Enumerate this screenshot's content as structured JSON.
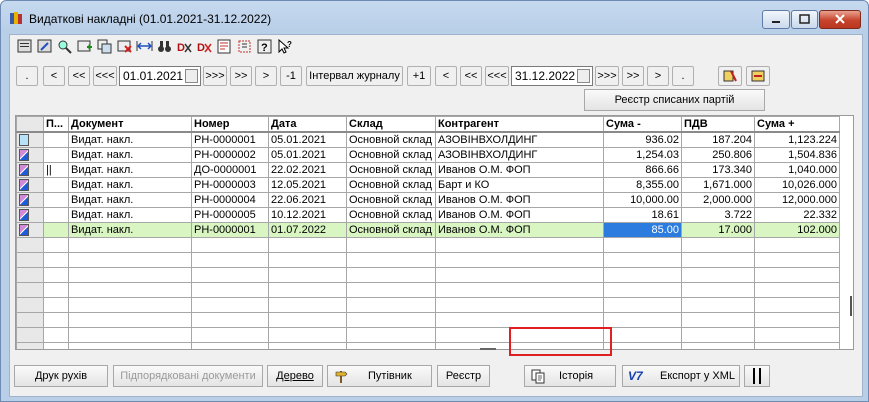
{
  "window": {
    "title": "Видаткові накладні (01.01.2021-31.12.2022)"
  },
  "toolbar": {
    "icons": [
      "new-doc-icon",
      "edit-doc-icon",
      "find-icon",
      "add-row-icon",
      "copy-icon",
      "delete-icon",
      "range-icon",
      "binoculars-icon",
      "dx-icon",
      "dx-red-icon",
      "history-icon",
      "filter-icon",
      "help-icon",
      "pointer-help-icon"
    ]
  },
  "nav": {
    "b_dot1": ".",
    "b_lt": "<",
    "b_ltlt": "<<",
    "b_ltltlt": "<<<",
    "date_from": "01.01.2021",
    "b_gtgtgt1": ">>>",
    "b_gtgt1": ">>",
    "b_gt1": ">",
    "b_minus1": "-1",
    "interval": "Інтервал журналу",
    "b_plus1": "+1",
    "b_lt2": "<",
    "b_ltlt2": "<<",
    "b_ltltlt2": "<<<",
    "date_to": "31.12.2022",
    "b_gtgtgt2": ">>>",
    "b_gtgt2": ">>",
    "b_gt2": ">",
    "b_dot2": "."
  },
  "reestr_partiy": "Реєстр списаних партій",
  "grid": {
    "headers": {
      "p": "П...",
      "doc": "Документ",
      "num": "Номер",
      "date": "Дата",
      "sklad": "Склад",
      "kontr": "Контрагент",
      "sum_minus": "Сума -",
      "pdv": "ПДВ",
      "sum_plus": "Сума +"
    },
    "rows": [
      {
        "icon": "doc",
        "p": "",
        "doc": "Видат. накл.",
        "num": "РН-0000001",
        "date": "05.01.2021",
        "sklad": "Основной склад",
        "kontr": "АЗОВІНВХОЛДИНГ",
        "sum_minus": "936.02",
        "pdv": "187.204",
        "sum_plus": "1,123.224"
      },
      {
        "icon": "mark",
        "p": "",
        "doc": "Видат. накл.",
        "num": "РН-0000002",
        "date": "05.01.2021",
        "sklad": "Основной склад",
        "kontr": "АЗОВІНВХОЛДИНГ",
        "sum_minus": "1,254.03",
        "pdv": "250.806",
        "sum_plus": "1,504.836"
      },
      {
        "icon": "mark",
        "p": "||",
        "doc": "Видат. накл.",
        "num": "ДО-0000001",
        "date": "22.02.2021",
        "sklad": "Основной склад",
        "kontr": "Иванов О.М. ФОП",
        "sum_minus": "866.66",
        "pdv": "173.340",
        "sum_plus": "1,040.000"
      },
      {
        "icon": "mark",
        "p": "",
        "doc": "Видат. накл.",
        "num": "РН-0000003",
        "date": "12.05.2021",
        "sklad": "Основной склад",
        "kontr": "Барт и КО",
        "sum_minus": "8,355.00",
        "pdv": "1,671.000",
        "sum_plus": "10,026.000"
      },
      {
        "icon": "mark",
        "p": "",
        "doc": "Видат. накл.",
        "num": "РН-0000004",
        "date": "22.06.2021",
        "sklad": "Основной склад",
        "kontr": "Иванов О.М. ФОП",
        "sum_minus": "10,000.00",
        "pdv": "2,000.000",
        "sum_plus": "12,000.000"
      },
      {
        "icon": "mark",
        "p": "",
        "doc": "Видат. накл.",
        "num": "РН-0000005",
        "date": "10.12.2021",
        "sklad": "Основной склад",
        "kontr": "Иванов О.М. ФОП",
        "sum_minus": "18.61",
        "pdv": "3.722",
        "sum_plus": "22.332"
      },
      {
        "icon": "mark",
        "p": "",
        "doc": "Видат. накл.",
        "num": "РН-0000001",
        "date": "01.07.2022",
        "sklad": "Основной склад",
        "kontr": "Иванов О.М. ФОП",
        "sum_minus": "85.00",
        "pdv": "17.000",
        "sum_plus": "102.000"
      }
    ]
  },
  "bottom": {
    "druk": "Друк рухів",
    "pidporyad": "Підпорядковані документи",
    "derevo": "Дерево",
    "putivnyk": "Путівник",
    "reestr": "Реєстр",
    "istoriya": "Історія",
    "eksport": "Експорт у XML",
    "v7_label": "V7"
  }
}
